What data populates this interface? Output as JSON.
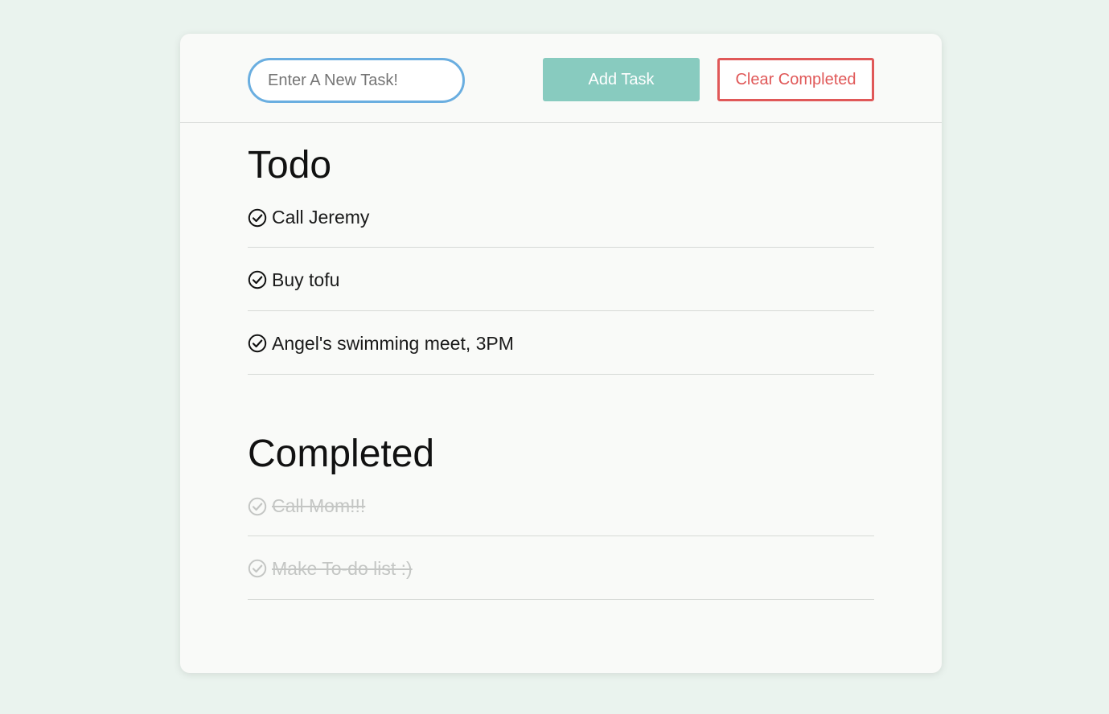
{
  "header": {
    "input_placeholder": "Enter A New Task!",
    "input_value": "",
    "add_label": "Add Task",
    "clear_label": "Clear Completed"
  },
  "todo": {
    "title": "Todo",
    "items": [
      {
        "label": "Call Jeremy",
        "icon": "check-circle-icon"
      },
      {
        "label": "Buy tofu",
        "icon": "check-circle-icon"
      },
      {
        "label": "Angel's swimming meet, 3PM",
        "icon": "check-circle-icon"
      }
    ]
  },
  "completed": {
    "title": "Completed",
    "items": [
      {
        "label": "Call Mom!!!",
        "icon": "check-circle-icon"
      },
      {
        "label": "Make To-do list :)",
        "icon": "check-circle-icon"
      }
    ]
  },
  "colors": {
    "page_background": "#eaf3ee",
    "card_background": "#f9faf8",
    "input_border": "#6aaee0",
    "add_button": "#88cbbf",
    "clear_button": "#e05858",
    "completed_text": "#c4c6c4"
  }
}
